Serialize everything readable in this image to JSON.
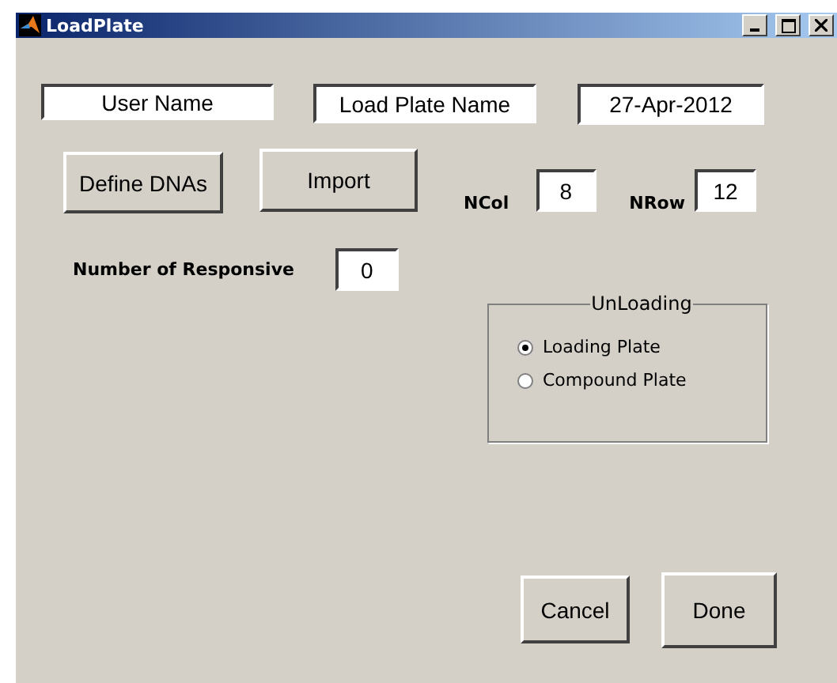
{
  "window": {
    "title": "LoadPlate"
  },
  "fields": {
    "user_name": "User Name",
    "plate_name": "Load Plate Name",
    "date": "27-Apr-2012"
  },
  "buttons": {
    "define": "Define DNAs",
    "import": "Import",
    "cancel": "Cancel",
    "done": "Done"
  },
  "ncol": {
    "label": "NCol",
    "value": "8"
  },
  "nrow": {
    "label": "NRow",
    "value": "12"
  },
  "responsive": {
    "label": "Number of Responsive",
    "value": "0"
  },
  "unloading": {
    "title": "UnLoading",
    "options": [
      {
        "label": "Loading Plate",
        "selected": true
      },
      {
        "label": "Compound Plate",
        "selected": false
      }
    ]
  }
}
